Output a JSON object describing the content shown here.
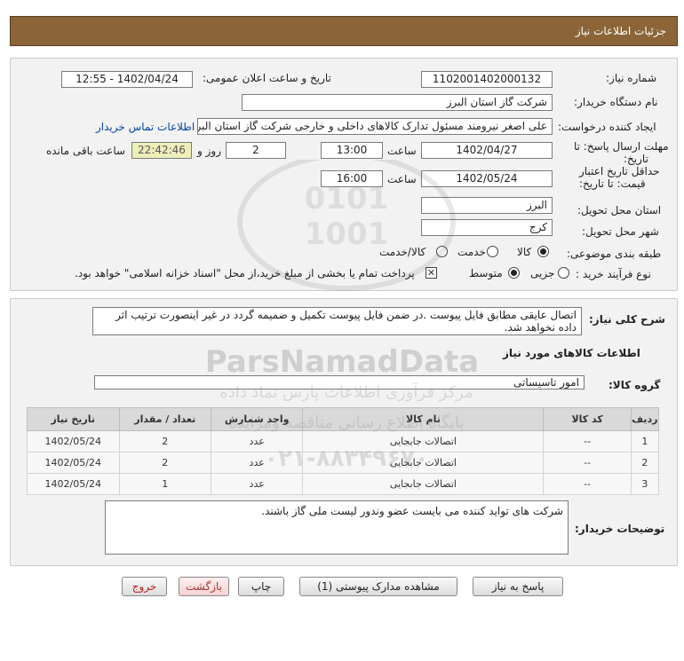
{
  "header": {
    "title": "جزئیات اطلاعات نیاز"
  },
  "form": {
    "need_number_label": "شماره نیاز:",
    "need_number": "1102001402000132",
    "announce_label": "تاریخ و ساعت اعلان عمومی:",
    "announce_value": "1402/04/24 - 12:55",
    "buyer_org_label": "نام دستگاه خریدار:",
    "buyer_org": "شرکت گاز استان البرز",
    "requester_label": "ایجاد کننده درخواست:",
    "requester": "علی اصغر نیرومند مسئول تدارک کالاهای داخلی و خارجی شرکت گاز استان البرز",
    "contact_link": "اطلاعات تماس خریدار",
    "deadline_label_1": "مهلت ارسال پاسخ: تا",
    "deadline_label_2": "تاریخ:",
    "deadline_date": "1402/04/27",
    "time_label": "ساعت",
    "deadline_time": "13:00",
    "days_value": "2",
    "days_label": "روز و",
    "remaining_time": "22:42:46",
    "remaining_label": "ساعت باقی مانده",
    "validity_label_1": "حداقل تاریخ اعتبار",
    "validity_label_2": "قیمت: تا تاریخ:",
    "validity_date": "1402/05/24",
    "validity_time": "16:00",
    "province_label": "استان محل تحویل:",
    "province": "البرز",
    "city_label": "شهر محل تحویل:",
    "city": "کرج",
    "category_label": "طبقه بندی موضوعی:",
    "category_options": [
      "کالا",
      "خدمت",
      "کالا/خدمت"
    ],
    "process_label": "نوع فرآیند خرید :",
    "process_options": [
      "جزیی",
      "متوسط"
    ],
    "payment_note": "پرداخت تمام یا بخشی از مبلغ خرید،از محل \"اسناد خزانه اسلامی\" خواهد بود."
  },
  "details": {
    "description_label": "شرح کلی نیاز:",
    "description": "اتصال عایقی مطابق فایل پیوست .در ضمن فایل پیوست تکمیل و ضمیمه گردد در غیر اینصورت ترتیب اثر داده نخواهد شد.",
    "goods_info_title": "اطلاعات کالاهای مورد نیاز",
    "goods_group_label": "گروه کالا:",
    "goods_group": "امور تاسیساتی",
    "table_headers": [
      "ردیف",
      "کد کالا",
      "نام کالا",
      "واحد شمارش",
      "تعداد / مقدار",
      "تاریخ نیاز"
    ],
    "rows": [
      [
        "1",
        "--",
        "اتصالات جابجایی",
        "عدد",
        "2",
        "1402/05/24"
      ],
      [
        "2",
        "--",
        "اتصالات جابجایی",
        "عدد",
        "2",
        "1402/05/24"
      ],
      [
        "3",
        "--",
        "اتصالات جابجایی",
        "عدد",
        "1",
        "1402/05/24"
      ]
    ],
    "buyer_notes_label": "توضیحات خریدار:",
    "buyer_notes": "شرکت های تواید کننده می بایست عضو وندور لیست ملی گاز باشند."
  },
  "buttons": {
    "reply": "پاسخ به نیاز",
    "view_docs": "مشاهده مدارک پیوستی (1)",
    "print": "چاپ",
    "back": "بازگشت",
    "exit": "خروج"
  },
  "watermark": {
    "brand": "ParsNamadData",
    "line1": "مرکز فرآوری اطلاعات پارس نماد داده",
    "line2": "پایگاه اطلاع رسانی مناقصه ومزایده",
    "phone": "۰۲۱-۸۸۳۴۹۶۷۰"
  },
  "colors": {
    "title_bar": "#8b6537",
    "link": "#0645ad",
    "clock_bg": "#eeeebb"
  }
}
